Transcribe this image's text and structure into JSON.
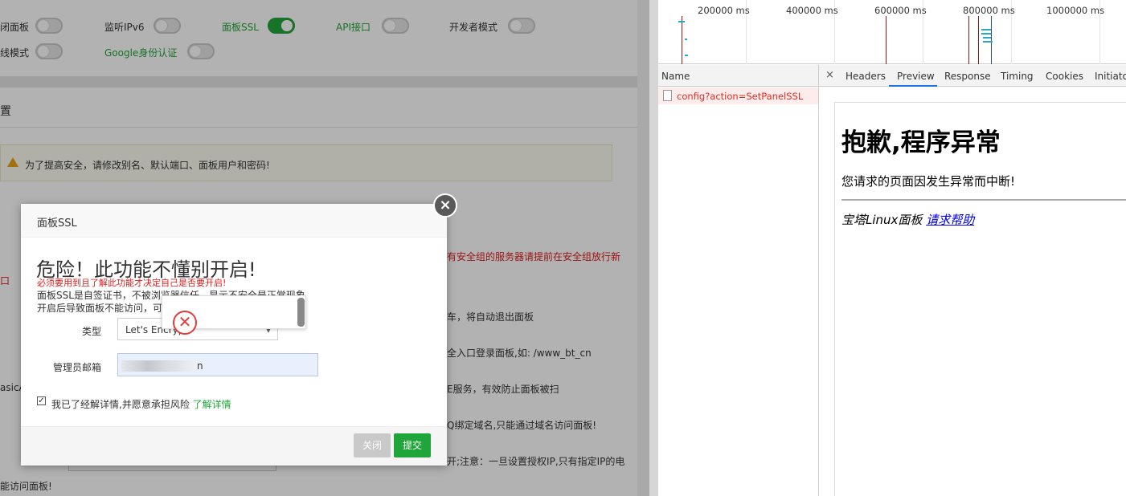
{
  "panel": {
    "toggles": [
      {
        "label": "闭面板",
        "on": false
      },
      {
        "label": "监听IPv6",
        "on": false
      },
      {
        "label": "面板SSL",
        "on": true
      },
      {
        "label": "API接口",
        "on": false
      },
      {
        "label": "开发者模式",
        "on": false
      },
      {
        "label": "线模式",
        "on": false
      },
      {
        "label": "Google身份认证",
        "on": false
      }
    ],
    "section_title": "置",
    "warning": "为了提高安全，请修改别名、默认端口、面板用户和密码!",
    "bg_texts": [
      "有安全组的服务器请提前在安全组放行新",
      "口",
      "车，将自动退出面板",
      "全入口登录面板,如: /www_bt_cn",
      "asicA",
      "E服务，有效防止面板被扫",
      "Q绑定域名,只能通过域名访问面板!",
      "开;注意：一旦设置授权IP,只有指定IP的电",
      "能访问面板!"
    ]
  },
  "modal": {
    "title": "面板SSL",
    "heading": "危险！此功能不懂别开启!",
    "subheading": "必须要用到且了解此功能才决定自己是否要开启!",
    "desc1": "面板SSL是自签证书，不被浏览器信任，显示不安全是正常现象",
    "desc2": "开启后导致面板不能访问，可",
    "type_label": "类型",
    "type_value": "Let's Encrypt",
    "email_label": "管理员邮箱",
    "email_value_tail": "n",
    "agree_text": "我已了经解详情,并愿意承担风险",
    "learn_more": "了解详情",
    "close_label": "关闭",
    "submit_label": "提交",
    "close_x": "×"
  },
  "toast": {
    "icon": "error-circle-icon",
    "symbol": "✕"
  },
  "devtools": {
    "timeline_labels": [
      "200000 ms",
      "400000 ms",
      "600000 ms",
      "800000 ms",
      "1000000 ms"
    ],
    "name_header": "Name",
    "close_symbol": "×",
    "tabs": [
      "Headers",
      "Preview",
      "Response",
      "Timing",
      "Cookies",
      "Initiator"
    ],
    "active_tab": "Preview",
    "request_name": "config?action=SetPanelSSL",
    "preview": {
      "h1": "抱歉,程序异常",
      "p": "您请求的页面因发生异常而中断!",
      "address_text": "宝塔Linux面板 ",
      "address_link": "请求帮助"
    }
  },
  "colors": {
    "accent_green": "#20a53a",
    "danger_red": "#e01c1c",
    "devtools_blue": "#1a73e8"
  }
}
